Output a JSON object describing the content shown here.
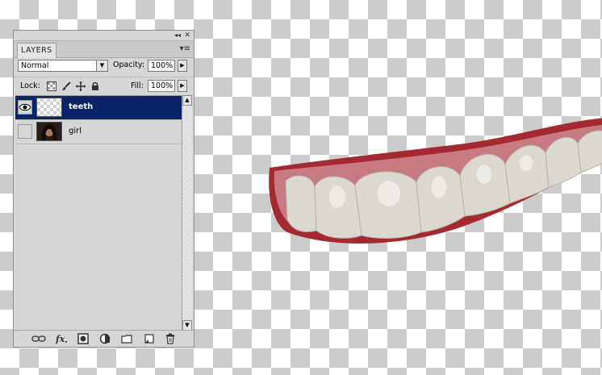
{
  "panel": {
    "tab_label": "LAYERS",
    "collapse_glyph": "◂◂",
    "close_glyph": "✕",
    "menu_glyph": "▾≡"
  },
  "blend_mode": {
    "value": "Normal",
    "arrow": "▼"
  },
  "opacity": {
    "label": "Opacity:",
    "value": "100%",
    "arrow": "▶"
  },
  "lock": {
    "label": "Lock:",
    "icons": [
      "lock-transparent-icon",
      "lock-image-icon",
      "lock-position-icon",
      "lock-all-icon"
    ]
  },
  "fill": {
    "label": "Fill:",
    "value": "100%",
    "arrow": "▶"
  },
  "layers": [
    {
      "name": "teeth",
      "visible": true,
      "selected": true,
      "thumbnail": "transparent"
    },
    {
      "name": "girl",
      "visible": false,
      "selected": false,
      "thumbnail": "photo"
    }
  ],
  "scrollbar": {
    "up": "▲",
    "down": "▼"
  },
  "footer_icons": [
    "link-layers-icon",
    "fx-icon",
    "layer-mask-icon",
    "adjustment-layer-icon",
    "new-group-icon",
    "new-layer-icon",
    "trash-icon"
  ],
  "colors": {
    "selection": "#0a246a",
    "panel_bg": "#d6d6d6",
    "lips": "#b0282e"
  }
}
